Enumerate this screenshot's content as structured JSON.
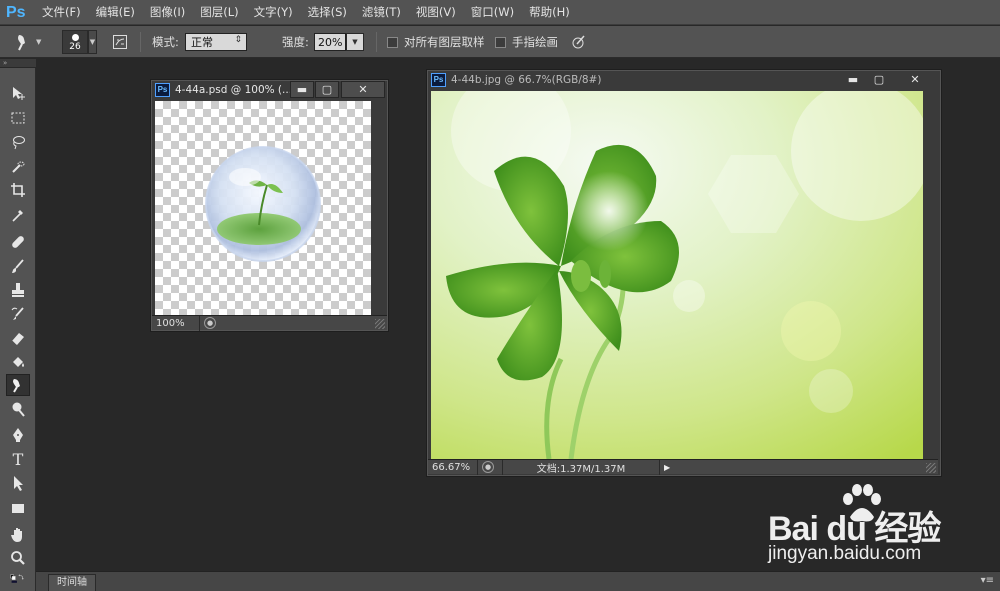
{
  "app": {
    "logo": "Ps",
    "menu": [
      "文件(F)",
      "编辑(E)",
      "图像(I)",
      "图层(L)",
      "文字(Y)",
      "选择(S)",
      "滤镜(T)",
      "视图(V)",
      "窗口(W)",
      "帮助(H)"
    ]
  },
  "options": {
    "brush_size": "26",
    "mode_label": "模式:",
    "mode_value": "正常",
    "strength_label": "强度:",
    "strength_value": "20%",
    "sample_all_layers": "对所有图层取样",
    "finger_painting": "手指绘画"
  },
  "tools": {
    "header": "»"
  },
  "doc_a": {
    "title": "4-44a.psd @ 100% (...",
    "zoom": "100%"
  },
  "doc_b": {
    "title": "4-44b.jpg @ 66.7%(RGB/8#)",
    "zoom": "66.67%",
    "doc_info": "文档:1.37M/1.37M"
  },
  "bottom": {
    "timeline_tab": "时间轴",
    "menu_glyph": "▾≡"
  },
  "watermark": {
    "text": "Bai du 经验",
    "url": "jingyan.baidu.com"
  },
  "colors": {
    "panel": "#535353",
    "workspace": "#282828",
    "accent": "#4fb6ff"
  }
}
